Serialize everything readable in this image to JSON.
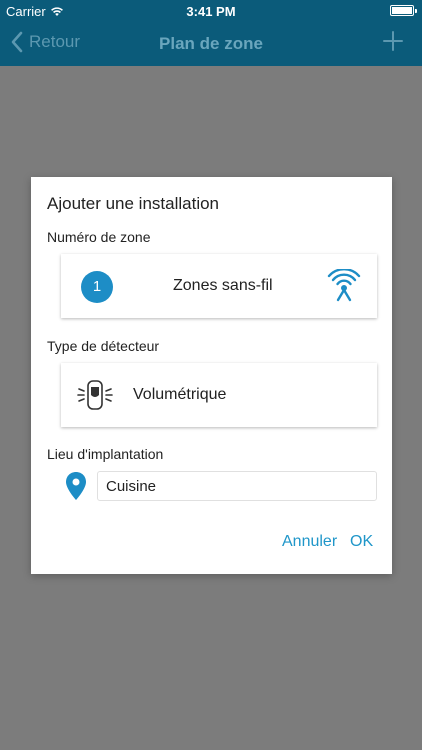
{
  "status": {
    "carrier": "Carrier",
    "time": "3:41 PM"
  },
  "nav": {
    "back_label": "Retour",
    "title": "Plan de zone"
  },
  "dialog": {
    "title": "Ajouter une installation",
    "zone_label": "Numéro de zone",
    "zone_number": "1",
    "zone_type": "Zones sans-fil",
    "detector_label": "Type de détecteur",
    "detector_type": "Volumétrique",
    "location_label": "Lieu d'implantation",
    "location_value": "Cuisine",
    "cancel_label": "Annuler",
    "ok_label": "OK"
  },
  "colors": {
    "header": "#0b5b7a",
    "accent": "#1d8dc6",
    "overlay": "#7c7c7c"
  }
}
